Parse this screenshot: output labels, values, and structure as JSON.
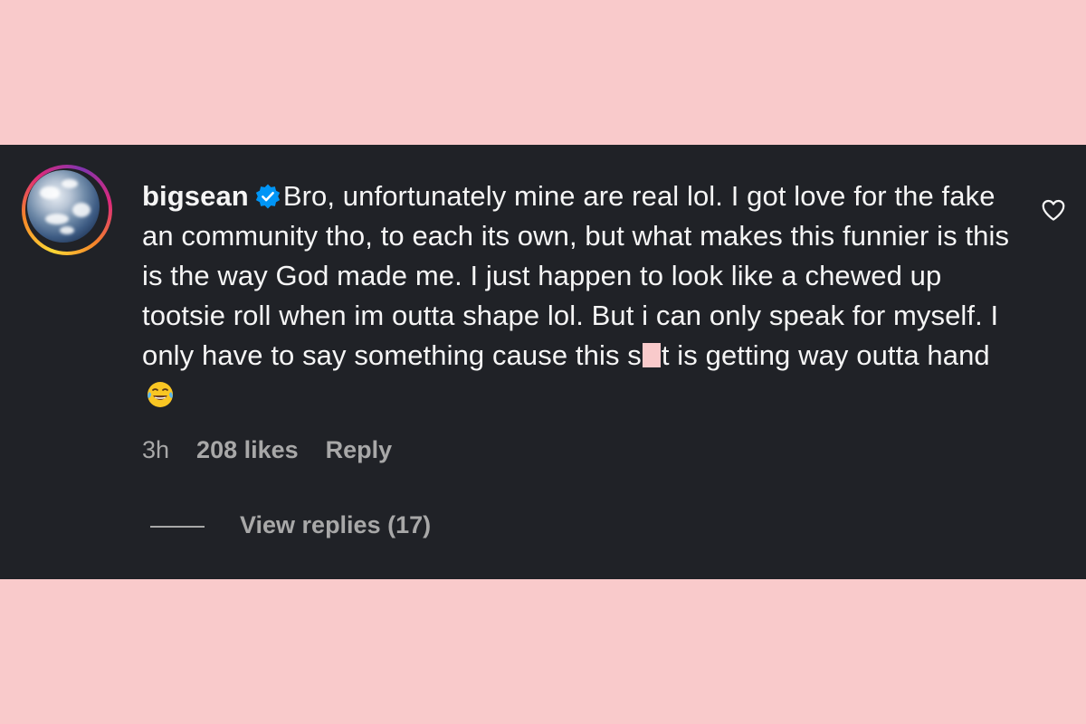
{
  "comment": {
    "username": "bigsean",
    "verified_icon": "verified-badge-icon",
    "text_part1": "Bro, unfortunately mine are real lol. I got love for the fake an community tho, to each its own, but what makes this funnier is this is the way God made me. I just happen to look like a chewed up tootsie roll when im outta shape lol. But i can only speak for myself. I only have to say something cause this s",
    "text_part2": "t is getting way outta hand",
    "emoji_icon": "laughing-crying-emoji-icon",
    "time": "3h",
    "likes": "208 likes",
    "reply_label": "Reply",
    "view_replies_label": "View replies (17)"
  },
  "colors": {
    "background": "#f9cacb",
    "panel": "#202227",
    "text": "#f5f5f5",
    "muted": "#a8a8a8",
    "verified_blue": "#0095f6"
  }
}
